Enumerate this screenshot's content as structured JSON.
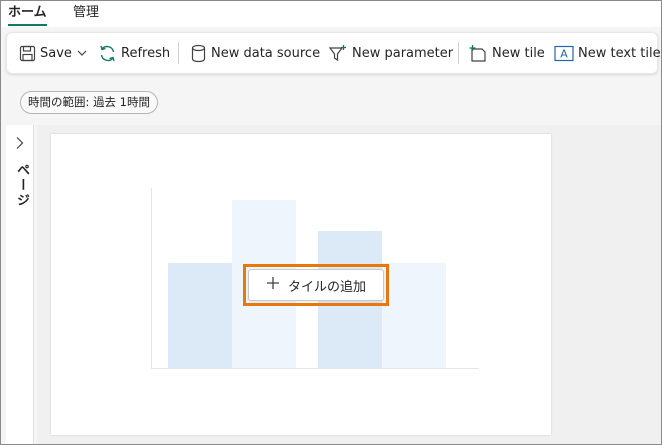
{
  "tabs": [
    {
      "label": "ホーム",
      "active": true
    },
    {
      "label": "管理",
      "active": false
    }
  ],
  "ribbon": {
    "save_label": "Save",
    "refresh_label": "Refresh",
    "new_data_source_label": "New data source",
    "new_parameter_label": "New parameter",
    "new_tile_label": "New tile",
    "new_text_tile_label": "New text tile"
  },
  "time_range": {
    "label": "時間の範囲: 過去 1時間"
  },
  "pages_panel": {
    "label": "ページ"
  },
  "canvas": {
    "add_tile_label": "タイルの追加"
  },
  "colors": {
    "accent_underline": "#117865",
    "highlight_border": "#e8780c",
    "placeholder_bar_dark": "#dce9f7",
    "placeholder_bar_light": "#eef5fc",
    "refresh_icon": "#117865",
    "text_tile_icon": "#2266aa"
  }
}
